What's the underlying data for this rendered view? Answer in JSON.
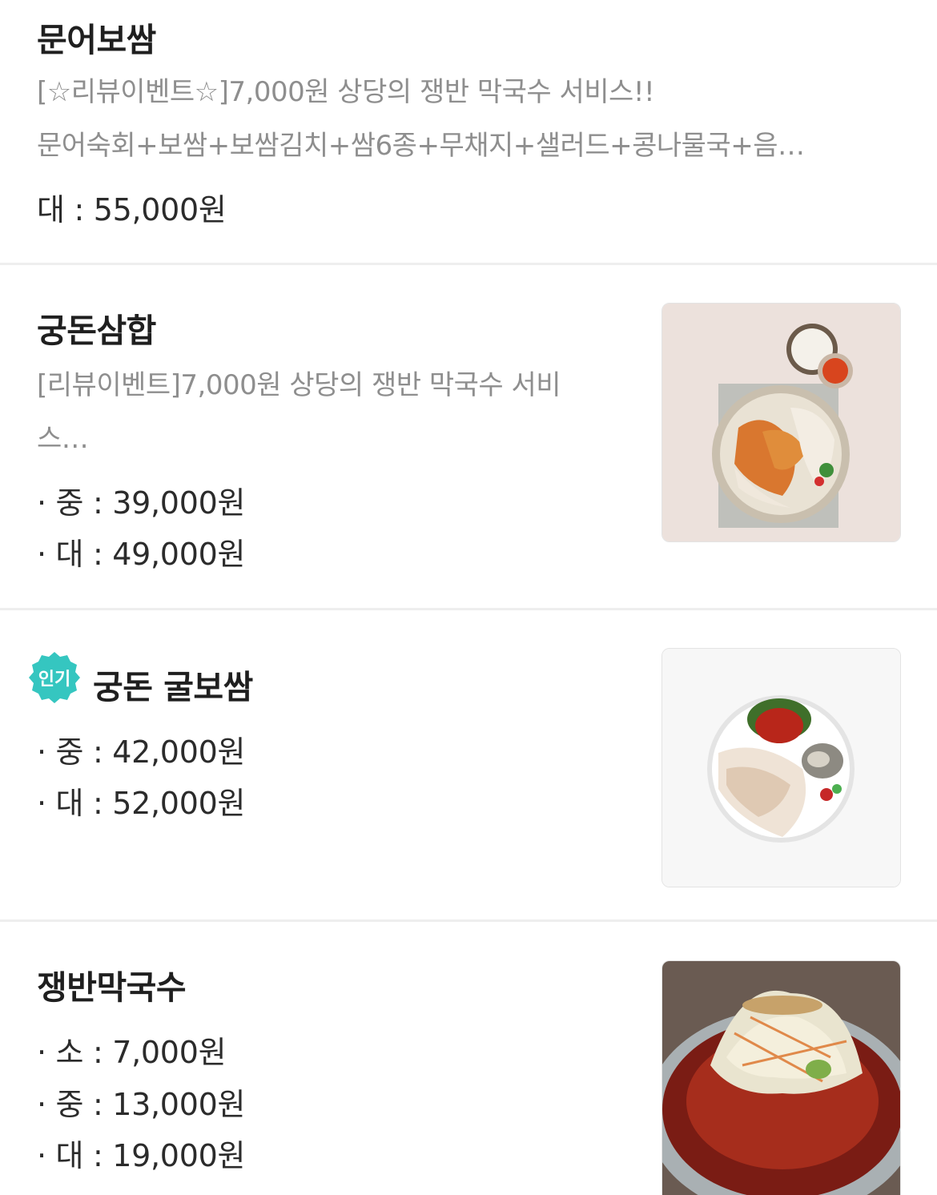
{
  "menu": {
    "items": [
      {
        "name": "문어보쌈",
        "description_lines": [
          "[☆리뷰이벤트☆]7,000원 상당의 쟁반 막국수 서비스!!",
          "문어숙회+보쌈+보쌈김치+쌈6종+무채지+샐러드+콩나물국+음…"
        ],
        "prices": [
          "대 : 55,000원"
        ]
      },
      {
        "name": "궁돈삼합",
        "description_lines": [
          "[리뷰이벤트]7,000원 상당의 쟁반 막국수 서비",
          "스…"
        ],
        "prices": [
          "· 중 : 39,000원",
          "· 대 : 49,000원"
        ],
        "image_icon": "bossam-platter-photo"
      },
      {
        "name": "궁돈 굴보쌈",
        "badge": "인기",
        "prices": [
          "· 중 : 42,000원",
          "· 대 : 52,000원"
        ],
        "image_icon": "oyster-bossam-photo"
      },
      {
        "name": "쟁반막국수",
        "prices": [
          "· 소 : 7,000원",
          "· 중 : 13,000원",
          "· 대 : 19,000원"
        ],
        "image_icon": "tray-makguksu-photo"
      }
    ]
  },
  "colors": {
    "badge": "#35c6c0",
    "divider": "#eeeeee",
    "description_text": "#8e8e8e",
    "title_text": "#1f1f1f"
  }
}
